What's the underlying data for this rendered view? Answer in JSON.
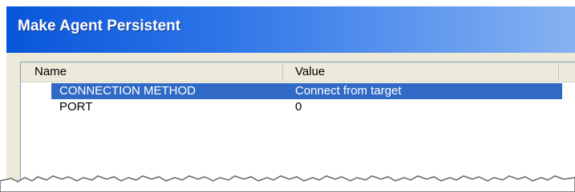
{
  "dialog": {
    "title": "Make Agent Persistent"
  },
  "list": {
    "columns": [
      "Name",
      "Value"
    ],
    "rows": [
      {
        "name": "CONNECTION METHOD",
        "value": "Connect from target",
        "selected": true
      },
      {
        "name": "PORT",
        "value": "0",
        "selected": false
      }
    ]
  },
  "colors": {
    "title_bar_start": "#0856d9",
    "title_bar_end": "#86b2f1",
    "dialog_face": "#ece9d8",
    "selection": "#316ac5"
  }
}
